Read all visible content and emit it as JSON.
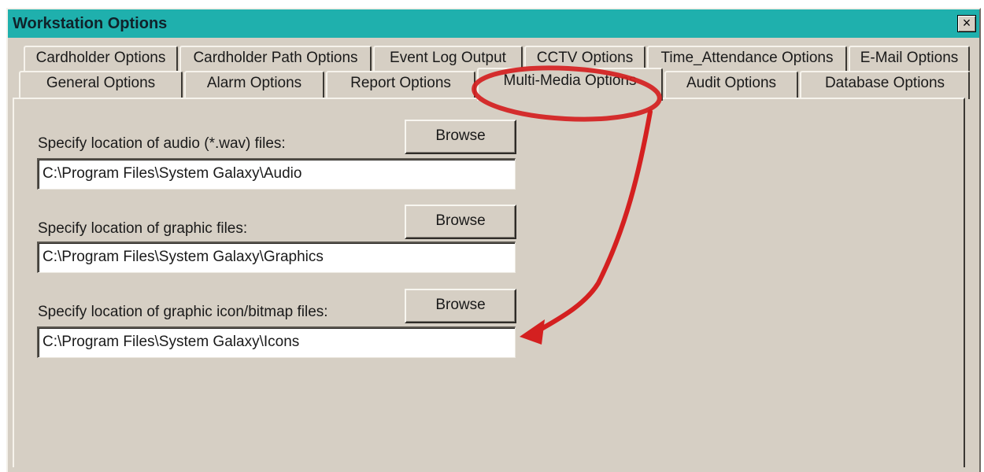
{
  "window": {
    "title": "Workstation Options",
    "close_symbol": "×"
  },
  "tabs": {
    "row1": [
      "Cardholder Options",
      "Cardholder Path Options",
      "Event Log Output",
      "CCTV Options",
      "Time_Attendance Options",
      "E-Mail Options"
    ],
    "row2": [
      "General Options",
      "Alarm Options",
      "Report Options",
      "Multi-Media Options",
      "Audit Options",
      "Database Options"
    ],
    "active": "Multi-Media Options"
  },
  "form": {
    "audio": {
      "label": "Specify location of audio (*.wav) files:",
      "value": "C:\\Program Files\\System Galaxy\\Audio",
      "button": "Browse"
    },
    "graphic": {
      "label": "Specify location of graphic files:",
      "value": "C:\\Program Files\\System Galaxy\\Graphics",
      "button": "Browse"
    },
    "icon": {
      "label": "Specify location of graphic icon/bitmap files:",
      "value": "C:\\Program Files\\System Galaxy\\Icons",
      "button": "Browse"
    }
  },
  "annotation": {
    "color": "#d42020",
    "shape": "ellipse-with-arrow"
  },
  "colors": {
    "titlebar": "#1fb0ad",
    "face": "#d6cfc4"
  }
}
